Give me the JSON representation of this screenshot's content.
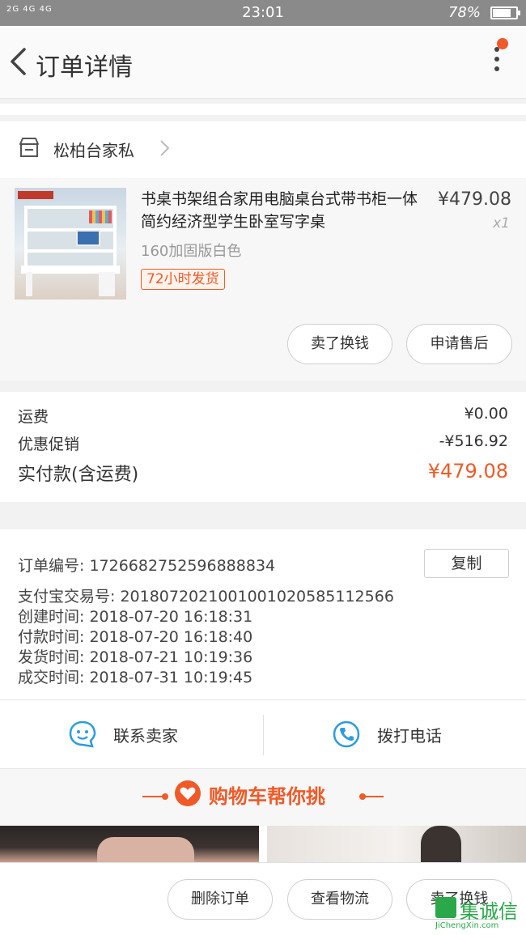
{
  "status_bar": {
    "signal": "2G 4G 4G",
    "time": "23:01",
    "battery": "78%",
    "battery_level": 0.78
  },
  "nav": {
    "title": "订单详情"
  },
  "shop": {
    "name": "松柏台家私"
  },
  "product": {
    "title": "书桌书架组合家用电脑桌台式带书柜一体简约经济型学生卧室写字桌",
    "price": "¥479.08",
    "quantity": "x1",
    "variant": "160加固版白色",
    "shipping_tag": "72小时发货",
    "actions": [
      "卖了换钱",
      "申请售后"
    ]
  },
  "fees": {
    "shipping_label": "运费",
    "shipping_value": "¥0.00",
    "discount_label": "优惠促销",
    "discount_value": "-¥516.92",
    "paid_label": "实付款(含运费)",
    "paid_value": "¥479.08"
  },
  "order_info": {
    "order_no": "订单编号:  1726682752596888834",
    "copy_label": "复制",
    "alipay_no": "支付宝交易号:  2018072021001001020585112566",
    "created": "创建时间:  2018-07-20 16:18:31",
    "paid": "付款时间:  2018-07-20 16:18:40",
    "shipped": "发货时间:  2018-07-21 10:19:36",
    "completed": "成交时间:  2018-07-31 10:19:45"
  },
  "contact": {
    "seller_label": "联系卖家",
    "phone_label": "拨打电话"
  },
  "recommend": {
    "title": "购物车帮你挑"
  },
  "bottom_bar": {
    "delete_label": "删除订单",
    "logistics_label": "查看物流",
    "resell_label": "卖了换钱"
  },
  "watermark": {
    "text": "集诚信",
    "sub": "JiChengXin.com"
  },
  "colors": {
    "accent": "#f05a28"
  }
}
